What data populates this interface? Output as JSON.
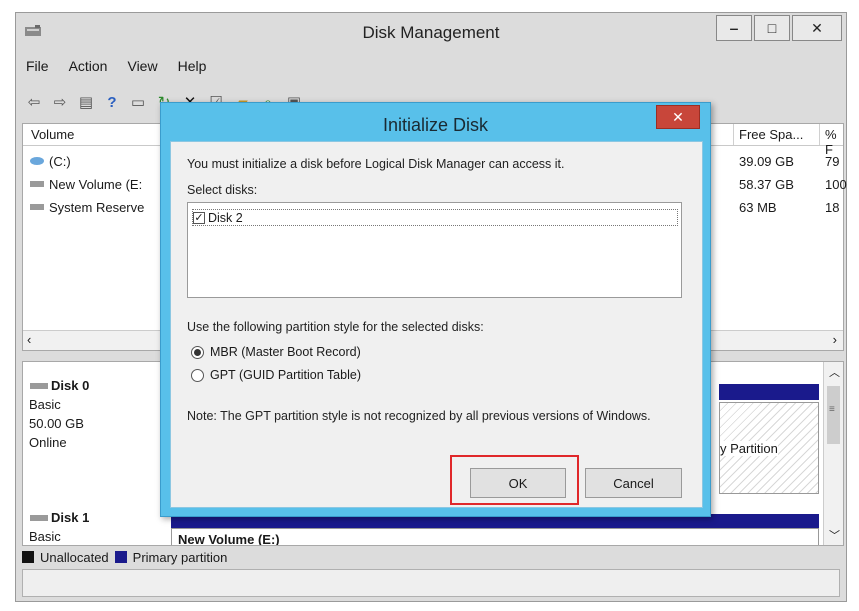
{
  "window": {
    "title": "Disk Management",
    "minimize": "‒",
    "maximize": "□",
    "close": "✕"
  },
  "menu": [
    "File",
    "Action",
    "View",
    "Help"
  ],
  "volumes": {
    "columns": [
      "Volume",
      "Free Spa...",
      "% F"
    ],
    "rows": [
      {
        "name": "(C:)",
        "free": "39.09 GB",
        "pct": "79"
      },
      {
        "name": "New Volume (E:",
        "free": "58.37 GB",
        "pct": "100"
      },
      {
        "name": "System Reserve",
        "free": "63 MB",
        "pct": "18"
      }
    ]
  },
  "disks": [
    {
      "name": "Disk 0",
      "type": "Basic",
      "size": "50.00 GB",
      "status": "Online"
    },
    {
      "name": "Disk 1",
      "type": "Basic"
    }
  ],
  "lower_right": {
    "partition_label": "y Partition",
    "new_volume_label": "New Volume  (E:)"
  },
  "legend": {
    "unallocated": "Unallocated",
    "primary": "Primary partition"
  },
  "dialog": {
    "title": "Initialize Disk",
    "close": "✕",
    "message": "You must initialize a disk before Logical Disk Manager can access it.",
    "select_label": "Select disks:",
    "disk_item": "Disk 2",
    "partition_label": "Use the following partition style for the selected disks:",
    "options": [
      {
        "label": "MBR (Master Boot Record)",
        "selected": true
      },
      {
        "label": "GPT (GUID Partition Table)",
        "selected": false
      }
    ],
    "note": "Note: The GPT partition style is not recognized by all previous versions of Windows.",
    "ok": "OK",
    "cancel": "Cancel"
  },
  "colors": {
    "dialog_frame": "#58c0ea",
    "close_red": "#c8463a",
    "highlight": "#e0272a",
    "primary_partition": "#1a1a8c"
  }
}
